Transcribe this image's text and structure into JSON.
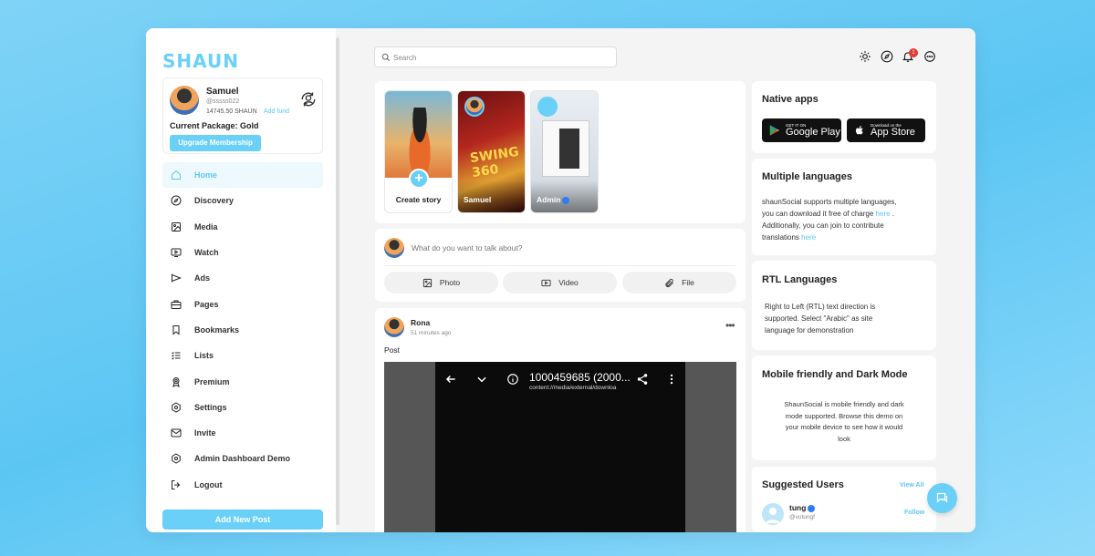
{
  "brand": {
    "logo_text": "SHAUN",
    "accent": "#6ad0f7"
  },
  "profile": {
    "name": "Samuel",
    "handle": "@sssss022",
    "balance": "14745.50 SHAUN",
    "add_fund": "Add fund",
    "package": "Current Package: Gold",
    "upgrade_label": "Upgrade Membership"
  },
  "nav": [
    {
      "label": "Home",
      "icon": "home-icon"
    },
    {
      "label": "Discovery",
      "icon": "compass-icon"
    },
    {
      "label": "Media",
      "icon": "image-icon"
    },
    {
      "label": "Watch",
      "icon": "video-icon"
    },
    {
      "label": "Ads",
      "icon": "megaphone-icon"
    },
    {
      "label": "Pages",
      "icon": "briefcase-icon"
    },
    {
      "label": "Bookmarks",
      "icon": "bookmark-icon"
    },
    {
      "label": "Lists",
      "icon": "list-icon"
    },
    {
      "label": "Premium",
      "icon": "award-icon"
    },
    {
      "label": "Settings",
      "icon": "gear-icon"
    },
    {
      "label": "Invite",
      "icon": "mail-icon"
    },
    {
      "label": "Admin Dashboard Demo",
      "icon": "gear-icon"
    },
    {
      "label": "Logout",
      "icon": "logout-icon"
    }
  ],
  "add_post_label": "Add New Post",
  "search": {
    "placeholder": "Search"
  },
  "notifications": {
    "count": "1"
  },
  "stories": {
    "create_label": "Create story",
    "items": [
      {
        "name": "Samuel",
        "poster_text": "SWING 360"
      },
      {
        "name": "Admin"
      }
    ]
  },
  "composer": {
    "placeholder": "What do you want to talk about?",
    "photo": "Photo",
    "video": "Video",
    "file": "File"
  },
  "post": {
    "author": "Rona",
    "time": "51 minutes ago",
    "text": "Post",
    "media_title": "1000459685 (2000...",
    "media_subtitle": "content://media/external/downloa"
  },
  "right": {
    "native_apps": {
      "title": "Native apps",
      "google_small": "GET IT ON",
      "google_big": "Google Play",
      "apple_small": "Download on the",
      "apple_big": "App Store"
    },
    "languages": {
      "title": "Multiple languages",
      "line1": "shaunSocial supports multiple languages,",
      "line2": "you can download it free of charge",
      "here1": "here",
      "line2_end": ".",
      "line3": "Additionally, you can join to contribute",
      "line4": "translations",
      "here2": "here"
    },
    "rtl": {
      "title": "RTL Languages",
      "line1": "Right to Left (RTL) text direction is",
      "line2": "supported. Select \"Arabic\" as site",
      "line3": "language for demonstration"
    },
    "mobile": {
      "title": "Mobile friendly and Dark Mode",
      "line1": "ShaunSocial is mobile friendly and dark",
      "line2": "mode supported. Browse this demo on",
      "line3": "your mobile device to see how it would",
      "line4": "look"
    },
    "suggested": {
      "title": "Suggested Users",
      "view_all": "View All",
      "user_name": "tung",
      "user_handle": "@vutungf",
      "follow": "Follow"
    }
  }
}
